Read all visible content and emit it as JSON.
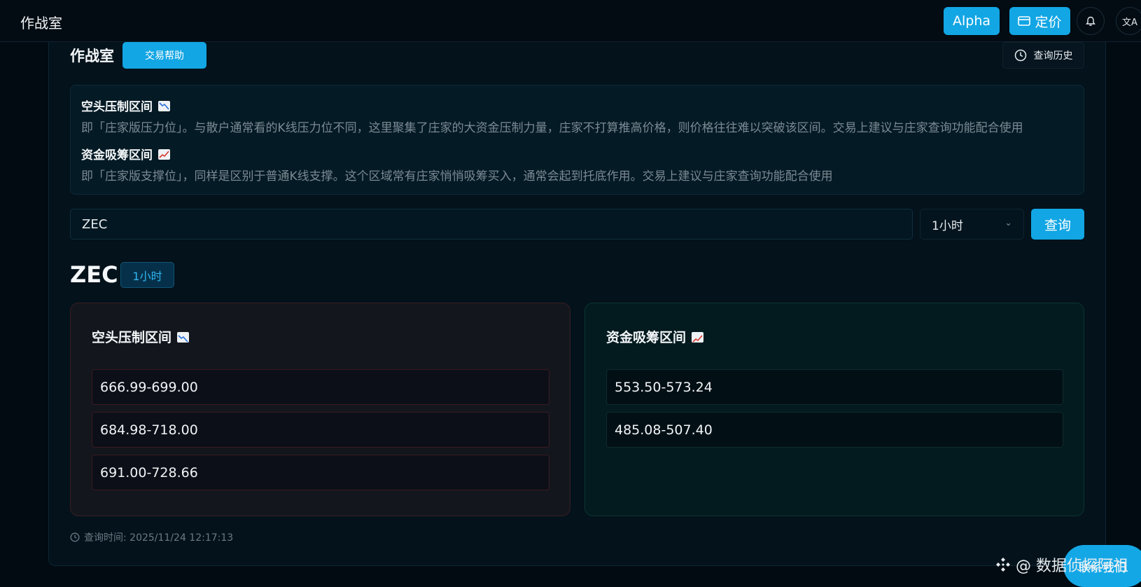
{
  "topbar": {
    "title": "作战室",
    "alpha_label": "Alpha",
    "pricing_label": "定价",
    "bell_icon": "bell-icon",
    "translate_icon": "translate-icon"
  },
  "header": {
    "title": "作战室",
    "help_label": "交易帮助",
    "history_label": "查询历史"
  },
  "info": {
    "short_title": "空头压制区间",
    "short_desc": "即「庄家版压力位」。与散户通常看的K线压力位不同，这里聚集了庄家的大资金压制力量，庄家不打算推高价格，则价格往往难以突破该区间。交易上建议与庄家查询功能配合使用",
    "accum_title": "资金吸筹区间",
    "accum_desc": "即「庄家版支撑位」，同样是区别于普通K线支撑。这个区域常有庄家悄悄吸筹买入，通常会起到托底作用。交易上建议与庄家查询功能配合使用"
  },
  "search": {
    "value": "ZEC",
    "interval": "1小时",
    "query_label": "查询"
  },
  "result": {
    "symbol": "ZEC",
    "interval_badge": "1小时",
    "short_card": {
      "title": "空头压制区间",
      "ranges": [
        "666.99-699.00",
        "684.98-718.00",
        "691.00-728.66"
      ]
    },
    "accum_card": {
      "title": "资金吸筹区间",
      "ranges": [
        "553.50-573.24",
        "485.08-507.40"
      ]
    },
    "timestamp": "查询时间: 2025/11/24 12:17:13"
  },
  "watermark": "@ 数据侦探阿祖",
  "corner_button": "联系我们",
  "colors": {
    "accent": "#12a6e4",
    "short_border": "#3a1d22",
    "accum_border": "#0c3530"
  }
}
